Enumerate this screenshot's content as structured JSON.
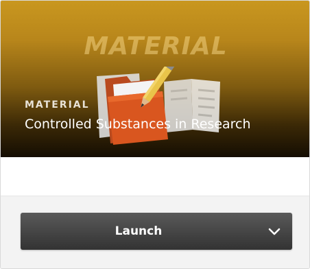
{
  "card": {
    "banner": {
      "watermark": "MATERIAL",
      "category": "MATERIAL",
      "title": "Controlled Substances in Research",
      "illustration_icon": "folder-with-pencil-and-notebook-icon"
    },
    "launch_button": {
      "label": "Launch",
      "dropdown_icon": "chevron-down-icon"
    }
  },
  "colors": {
    "banner_top": "#c9971f",
    "banner_bottom": "#140d02",
    "button_bg": "#444444",
    "footer_bg": "#f3f3f3"
  }
}
